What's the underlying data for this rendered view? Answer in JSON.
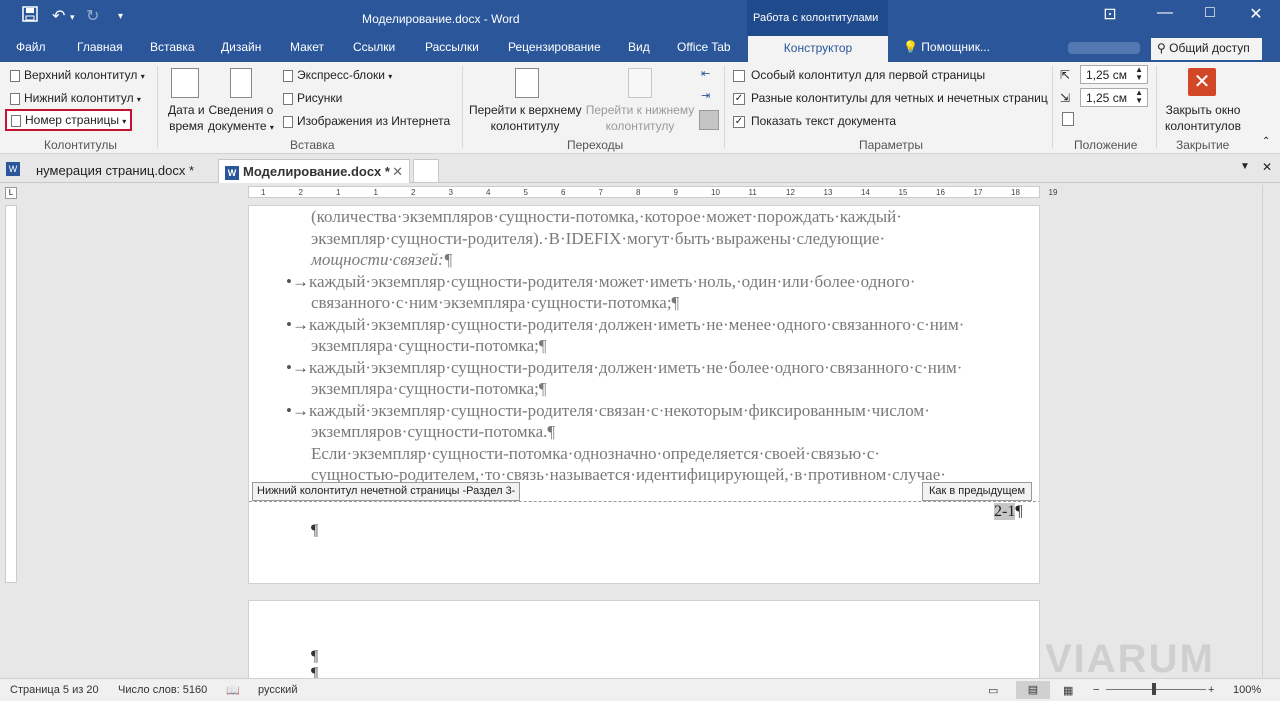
{
  "window": {
    "title": "Моделирование.docx - Word",
    "context_tab_title": "Работа с колонтитулами"
  },
  "qat": {
    "save_icon": "save-icon",
    "undo_icon": "undo-icon",
    "redo_icon": "redo-icon",
    "customize_icon": "customize-icon"
  },
  "tabs": [
    "Файл",
    "Главная",
    "Вставка",
    "Дизайн",
    "Макет",
    "Ссылки",
    "Рассылки",
    "Рецензирование",
    "Вид",
    "Office Tab"
  ],
  "active_tab": "Конструктор",
  "help_search": "Помощник...",
  "share_label": "Общий доступ",
  "ribbon": {
    "headers_footers": {
      "header": "Верхний колонтитул",
      "footer": "Нижний колонтитул",
      "page_number": "Номер страницы",
      "group_label": "Колонтитулы"
    },
    "insert": {
      "date_time_line1": "Дата и",
      "date_time_line2": "время",
      "doc_info_line1": "Сведения о",
      "doc_info_line2": "документе",
      "quick_parts": "Экспресс-блоки",
      "pictures": "Рисунки",
      "online_pictures": "Изображения из Интернета",
      "group_label": "Вставка"
    },
    "navigation": {
      "goto_header_line1": "Перейти к верхнему",
      "goto_header_line2": "колонтитулу",
      "goto_footer_line1": "Перейти к нижнему",
      "goto_footer_line2": "колонтитулу",
      "group_label": "Переходы"
    },
    "options": {
      "different_first": {
        "label": "Особый колонтитул для первой страницы",
        "checked": false
      },
      "different_odd_even": {
        "label": "Разные колонтитулы для четных и нечетных страниц",
        "checked": true
      },
      "show_doc_text": {
        "label": "Показать текст документа",
        "checked": true
      },
      "group_label": "Параметры"
    },
    "position": {
      "header_from_top": "1,25 см",
      "footer_from_bottom": "1,25 см",
      "group_label": "Положение"
    },
    "close": {
      "close_line1": "Закрыть окно",
      "close_line2": "колонтитулов",
      "group_label": "Закрытие"
    }
  },
  "doc_tabs": [
    {
      "label": "нумерация страниц.docx *",
      "active": false
    },
    {
      "label": "Моделирование.docx *",
      "active": true
    }
  ],
  "ruler_numbers": [
    "1",
    "2",
    "1",
    "1",
    "2",
    "3",
    "4",
    "5",
    "6",
    "7",
    "8",
    "9",
    "10",
    "11",
    "12",
    "13",
    "14",
    "15",
    "16",
    "17",
    "18",
    "19"
  ],
  "page1": {
    "lines": [
      {
        "text": "(количества·экземпляров·сущности-потомка,·которое·может·порождать·каждый·",
        "bullet": false
      },
      {
        "text": "экземпляр·сущности-родителя).·В·IDEFIX·могут·быть·выражены·следующие·",
        "bullet": false
      },
      {
        "text": "мощности·связей:¶",
        "bullet": false,
        "italic_part": "мощности·связей"
      },
      {
        "text": "каждый·экземпляр·сущности-родителя·может·иметь·ноль,·один·или·более·одного·",
        "bullet": true
      },
      {
        "text": "связанного·с·ним·экземпляра·сущности-потомка;¶",
        "bullet": false
      },
      {
        "text": "каждый·экземпляр·сущности-родителя·должен·иметь·не·менее·одного·связанного·с·ним·",
        "bullet": true
      },
      {
        "text": "экземпляра·сущности-потомка;¶",
        "bullet": false
      },
      {
        "text": "каждый·экземпляр·сущности-родителя·должен·иметь·не·более·одного·связанного·с·ним·",
        "bullet": true
      },
      {
        "text": "экземпляра·сущности-потомка;¶",
        "bullet": false
      },
      {
        "text": "каждый·экземпляр·сущности-родителя·связан·с·некоторым·фиксированным·числом·",
        "bullet": true
      },
      {
        "text": "экземпляров·сущности-потомка.¶",
        "bullet": false
      },
      {
        "text": "Если·экземпляр·сущности-потомка·однозначно·определяется·своей·связью·с·",
        "bullet": false
      },
      {
        "text": "сущностью-родителем,·то·связь·называется·идентифицирующей,·в·противном·случае·",
        "bullet": false
      }
    ],
    "bullet_marker": "•→",
    "footer_tag": "Нижний колонтитул нечетной страницы -Раздел 3-",
    "same_as_prev": "Как в предыдущем",
    "page_number": "2-1",
    "pilcrow": "¶"
  },
  "page2": {
    "pilcrow": "¶"
  },
  "status": {
    "page": "Страница 5 из 20",
    "words": "Число слов: 5160",
    "language": "русский",
    "zoom": "100%"
  },
  "watermark": "VIARUM",
  "colors": {
    "accent": "#2b579a",
    "highlight_box": "#c41230"
  }
}
